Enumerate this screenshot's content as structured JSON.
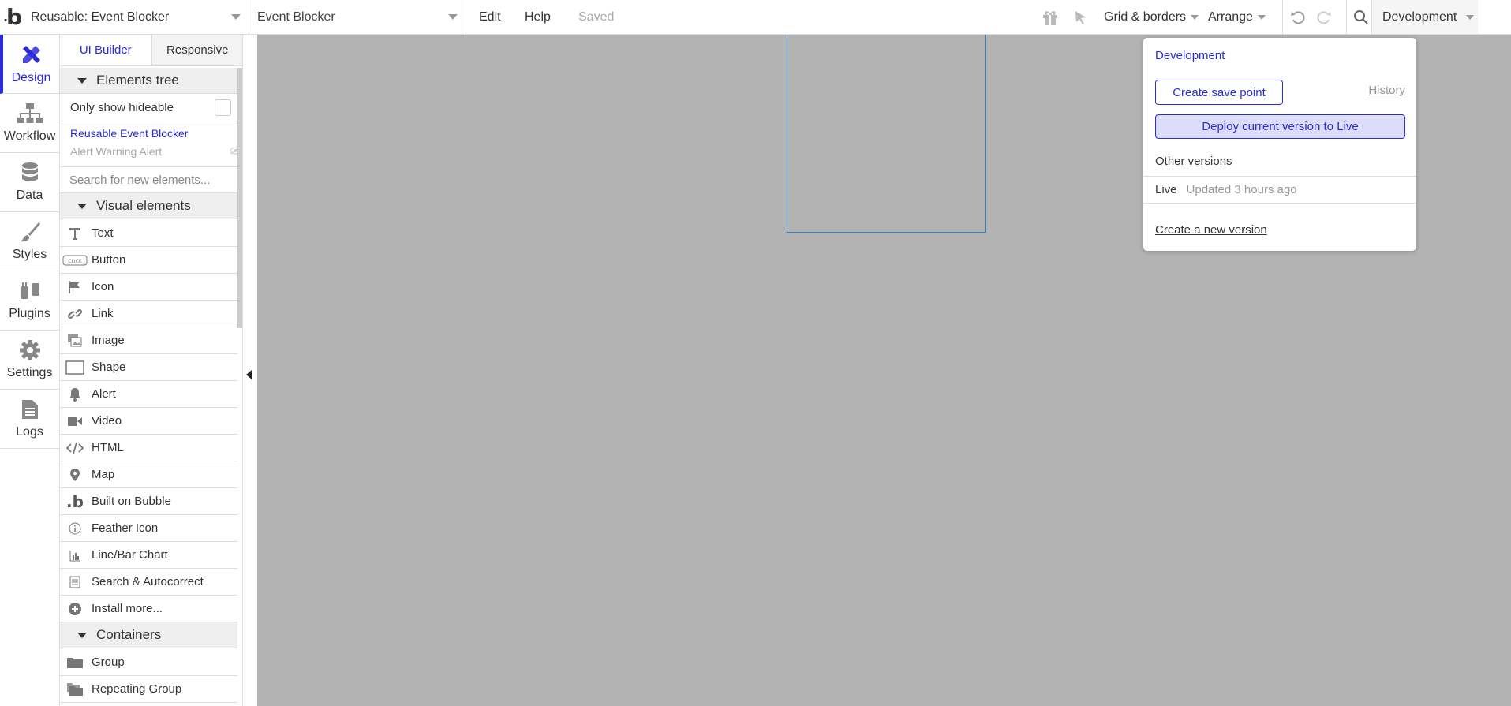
{
  "topbar": {
    "logo": "b",
    "page_select": "Reusable: Event Blocker",
    "element_select": "Event Blocker",
    "menu_edit": "Edit",
    "menu_help": "Help",
    "saved_status": "Saved",
    "grid_borders": "Grid & borders",
    "arrange": "Arrange",
    "version": "Development"
  },
  "rail": {
    "items": [
      {
        "label": "Design",
        "icon": "design-icon"
      },
      {
        "label": "Workflow",
        "icon": "workflow-icon"
      },
      {
        "label": "Data",
        "icon": "database-icon"
      },
      {
        "label": "Styles",
        "icon": "brush-icon"
      },
      {
        "label": "Plugins",
        "icon": "plug-icon"
      },
      {
        "label": "Settings",
        "icon": "gear-icon"
      },
      {
        "label": "Logs",
        "icon": "document-icon"
      }
    ]
  },
  "panel": {
    "tabs": [
      "UI Builder",
      "Responsive"
    ],
    "elements_tree": "Elements tree",
    "only_hideable": "Only show hideable",
    "tree_items": [
      "Reusable Event Blocker",
      "Alert Warning Alert"
    ],
    "search_placeholder": "Search for new elements...",
    "visual_section": "Visual elements",
    "visual_items": [
      {
        "label": "Text",
        "icon": "text-icon"
      },
      {
        "label": "Button",
        "icon": "button-icon"
      },
      {
        "label": "Icon",
        "icon": "flag-icon"
      },
      {
        "label": "Link",
        "icon": "link-icon"
      },
      {
        "label": "Image",
        "icon": "image-icon"
      },
      {
        "label": "Shape",
        "icon": "shape-icon"
      },
      {
        "label": "Alert",
        "icon": "bell-icon"
      },
      {
        "label": "Video",
        "icon": "video-icon"
      },
      {
        "label": "HTML",
        "icon": "code-icon"
      },
      {
        "label": "Map",
        "icon": "map-pin-icon"
      },
      {
        "label": "Built on Bubble",
        "icon": "bubble-logo-icon"
      },
      {
        "label": "Feather Icon",
        "icon": "info-circle-icon"
      },
      {
        "label": "Line/Bar Chart",
        "icon": "bar-chart-icon"
      },
      {
        "label": "Search & Autocorrect",
        "icon": "list-icon"
      },
      {
        "label": "Install more...",
        "icon": "plus-circle-icon"
      }
    ],
    "containers_section": "Containers",
    "container_items": [
      {
        "label": "Group",
        "icon": "folder-icon"
      },
      {
        "label": "Repeating Group",
        "icon": "folders-icon"
      }
    ]
  },
  "popup": {
    "title": "Development",
    "save_point": "Create save point",
    "history": "History",
    "deploy": "Deploy current version to Live",
    "other_versions": "Other versions",
    "live_label": "Live",
    "live_updated": "Updated 3 hours ago",
    "new_version": "Create a new version"
  }
}
